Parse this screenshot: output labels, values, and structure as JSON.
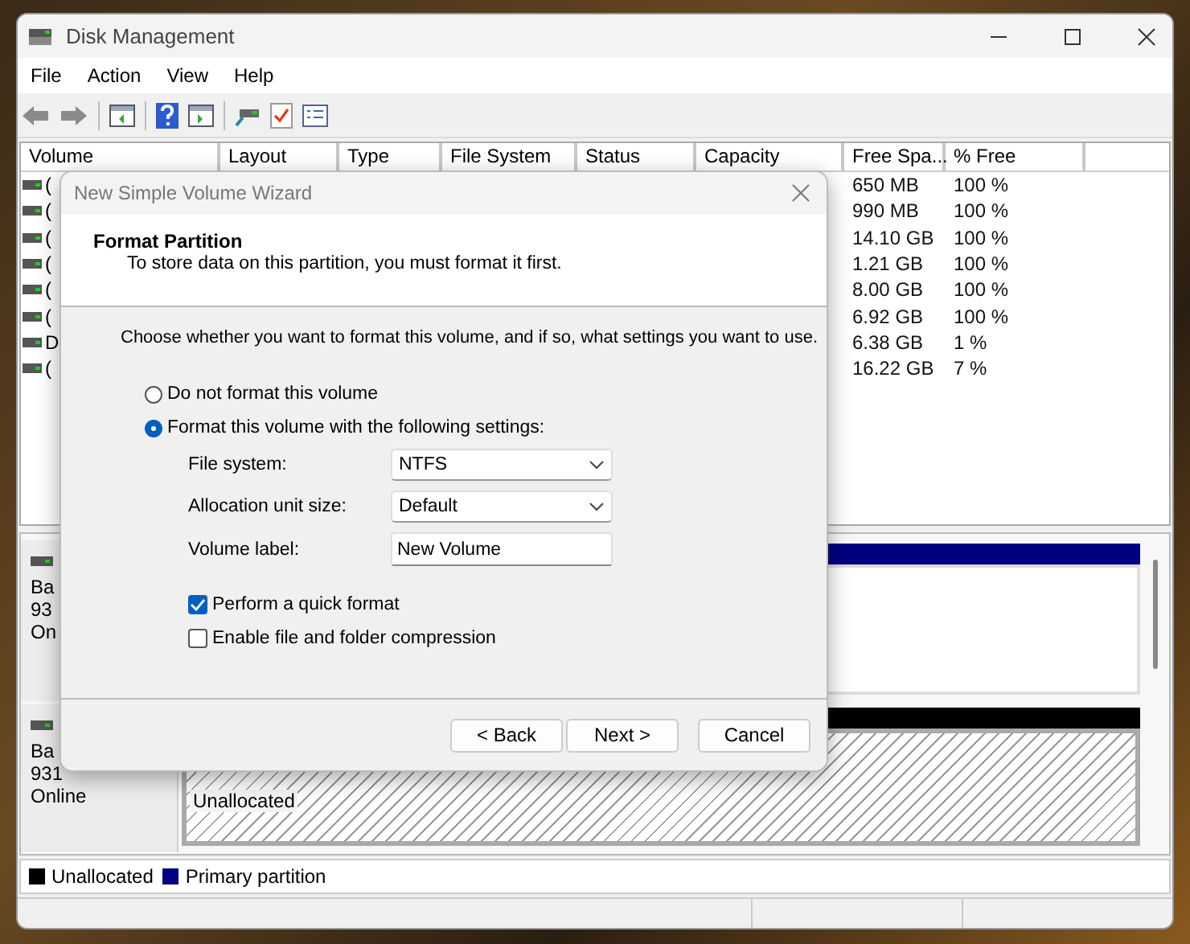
{
  "window": {
    "title": "Disk Management"
  },
  "menu": [
    {
      "label": "File"
    },
    {
      "label": "Action"
    },
    {
      "label": "View"
    },
    {
      "label": "Help"
    }
  ],
  "volume_list": {
    "columns": [
      "Volume",
      "Layout",
      "Type",
      "File System",
      "Status",
      "Capacity",
      "Free Spa...",
      "% Free"
    ],
    "rows": [
      {
        "volume": "(",
        "free_space": "650 MB",
        "percent_free": "100 %"
      },
      {
        "volume": "(",
        "free_space": "990 MB",
        "percent_free": "100 %"
      },
      {
        "volume": "(",
        "free_space": "14.10 GB",
        "percent_free": "100 %"
      },
      {
        "volume": "(",
        "free_space": "1.21 GB",
        "percent_free": "100 %"
      },
      {
        "volume": "(",
        "free_space": "8.00 GB",
        "percent_free": "100 %"
      },
      {
        "volume": "(",
        "free_space": "6.92 GB",
        "percent_free": "100 %"
      },
      {
        "volume": "D",
        "free_space": "6.38 GB",
        "percent_free": "1 %"
      },
      {
        "volume": "(",
        "free_space": "16.22 GB",
        "percent_free": "7 %"
      }
    ]
  },
  "disks": [
    {
      "lines": [
        "Ba",
        "93",
        "On"
      ],
      "partition": {
        "kind": "primary"
      }
    },
    {
      "lines": [
        "Ba",
        "931",
        "Online"
      ],
      "partition": {
        "kind": "unallocated",
        "label": "Unallocated"
      }
    }
  ],
  "legend": [
    {
      "kind": "unallocated",
      "label": "Unallocated",
      "color": "#000000"
    },
    {
      "kind": "primary",
      "label": "Primary partition",
      "color": "#000080"
    }
  ],
  "dialog": {
    "title": "New Simple Volume Wizard",
    "heading": "Format Partition",
    "subheading": "To store data on this partition, you must format it first.",
    "instruction": "Choose whether you want to format this volume, and if so, what settings you want to use.",
    "options": [
      {
        "label": "Do not format this volume",
        "selected": false
      },
      {
        "label": "Format this volume with the following settings:",
        "selected": true
      }
    ],
    "fields": [
      {
        "kind": "select",
        "label": "File system:",
        "value": "NTFS"
      },
      {
        "kind": "select",
        "label": "Allocation unit size:",
        "value": "Default"
      },
      {
        "kind": "text",
        "label": "Volume label:",
        "value": "New Volume"
      }
    ],
    "checkboxes": [
      {
        "label": "Perform a quick format",
        "checked": true
      },
      {
        "label": "Enable file and folder compression",
        "checked": false
      }
    ],
    "buttons": [
      {
        "label": "< Back"
      },
      {
        "label": "Next >"
      },
      {
        "label": "Cancel"
      }
    ]
  }
}
